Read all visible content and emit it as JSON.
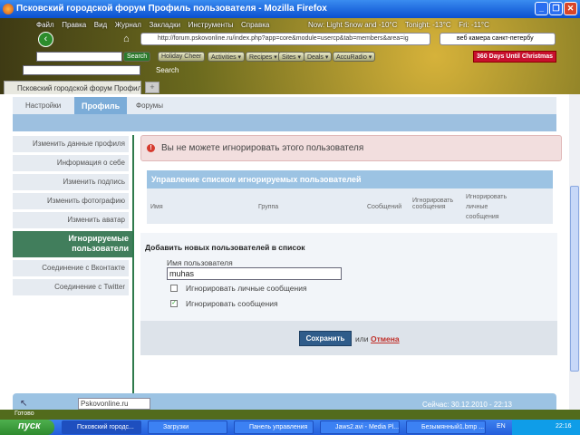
{
  "window": {
    "title": "Псковский городской форум Профиль пользователя - Mozilla Firefox",
    "min": "_",
    "max": "❐",
    "close": "✕"
  },
  "menu": [
    "Файл",
    "Правка",
    "Вид",
    "Журнал",
    "Закладки",
    "Инструменты",
    "Справка"
  ],
  "weather": [
    "Now: Light Snow and -10°C",
    "Tonight: -13°C",
    "Fri: -11°C"
  ],
  "nav": {
    "url": "http://forum.pskovonline.ru/index.php?app=core&module=usercp&tab=members&area=ig",
    "search": "веб камера санкт-петербу"
  },
  "toolbar": {
    "search_btn": "Search",
    "buttons": [
      "Holiday Cheer",
      "Activities ▾",
      "Recipes ▾",
      "Sites ▾",
      "Deals ▾",
      "AccuRadio ▾"
    ],
    "countdown_num": "360",
    "countdown": "Days Until Christmas",
    "google_search": "Search"
  },
  "browser_tab": {
    "label": "Псковский городской форум Профиль...",
    "new": "+"
  },
  "page": {
    "tabs": [
      "Настройки",
      "Профиль",
      "Форумы"
    ],
    "sidebar": [
      "Изменить данные профиля",
      "Информация о себе",
      "Изменить подпись",
      "Изменить фотографию",
      "Изменить аватар",
      "Игнорируемые пользователи",
      "Соединение с Вконтакте",
      "Соединение с Twitter"
    ],
    "error": "Вы не можете игнорировать этого пользователя",
    "table_title": "Управление списком игнорируемых пользователей",
    "columns": [
      "Имя",
      "Группа",
      "Сообщений",
      "Игнорировать сообщения",
      "Игнорировать личные сообщения"
    ],
    "form_title": "Добавить новых пользователей в список",
    "username_label": "Имя пользователя",
    "username_value": "muhas",
    "opt_pm": "Игнорировать личные сообщения",
    "opt_posts": "Игнорировать сообщения",
    "save": "Сохранить",
    "or": "или",
    "cancel": "Отмена",
    "footer_select": "Pskovonline.ru",
    "footer_time": "Сейчас: 30.12.2010 - 22:13"
  },
  "status": "Готово",
  "taskbar": {
    "start": "пуск",
    "tasks": [
      "Псковский городс...",
      "Загрузки",
      "Панель управления",
      "Jaws2.avi - Media Pl...",
      "Безымянный1.bmp ..."
    ],
    "lang": "EN",
    "clock": "22:16"
  }
}
